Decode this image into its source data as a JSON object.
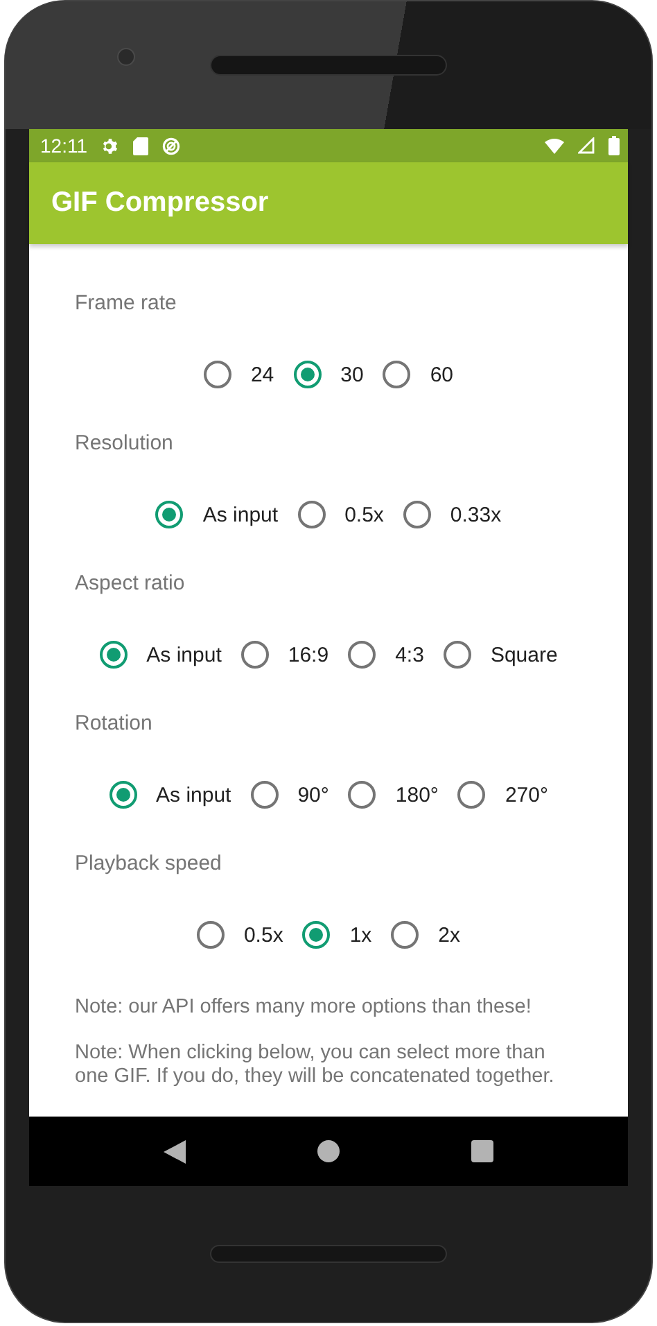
{
  "status_bar": {
    "time": "12:11"
  },
  "app_bar": {
    "title": "GIF Compressor"
  },
  "settings": [
    {
      "label": "Frame rate",
      "options": [
        {
          "label": "24",
          "selected": false
        },
        {
          "label": "30",
          "selected": true
        },
        {
          "label": "60",
          "selected": false
        }
      ]
    },
    {
      "label": "Resolution",
      "options": [
        {
          "label": "As input",
          "selected": true
        },
        {
          "label": "0.5x",
          "selected": false
        },
        {
          "label": "0.33x",
          "selected": false
        }
      ]
    },
    {
      "label": "Aspect ratio",
      "options": [
        {
          "label": "As input",
          "selected": true
        },
        {
          "label": "16:9",
          "selected": false
        },
        {
          "label": "4:3",
          "selected": false
        },
        {
          "label": "Square",
          "selected": false
        }
      ]
    },
    {
      "label": "Rotation",
      "options": [
        {
          "label": "As input",
          "selected": true
        },
        {
          "label": "90°",
          "selected": false
        },
        {
          "label": "180°",
          "selected": false
        },
        {
          "label": "270°",
          "selected": false
        }
      ]
    },
    {
      "label": "Playback speed",
      "options": [
        {
          "label": "0.5x",
          "selected": false
        },
        {
          "label": "1x",
          "selected": true
        },
        {
          "label": "2x",
          "selected": false
        }
      ]
    }
  ],
  "notes": [
    "Note: our API offers many more options than these!",
    "Note: When clicking below, you can select more than one GIF. If you do, they will be concatenated together."
  ]
}
